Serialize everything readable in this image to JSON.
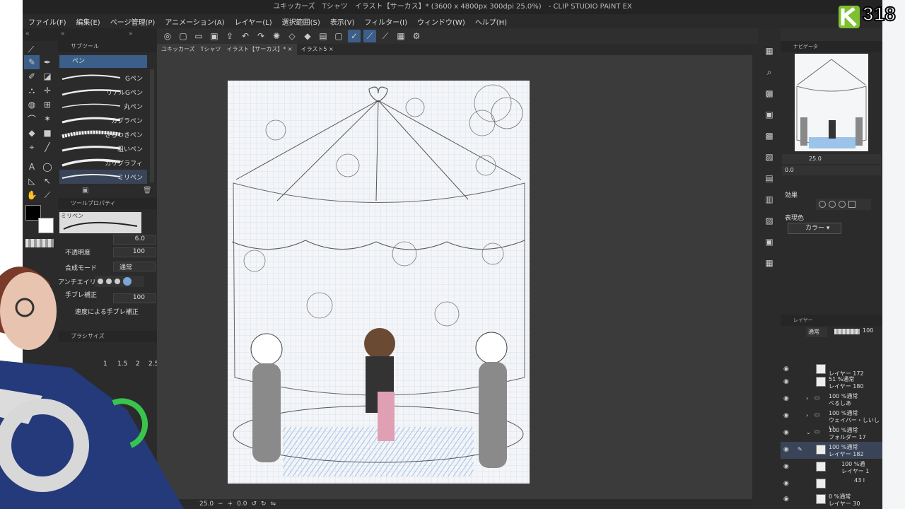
{
  "window": {
    "title": "ユキッカーズ　Tシャツ　イラスト【サーカス】* (3600 x 4800px 300dpi 25.0%)　- CLIP STUDIO PAINT EX"
  },
  "menu": [
    "ファイル(F)",
    "編集(E)",
    "ページ管理(P)",
    "アニメーション(A)",
    "レイヤー(L)",
    "選択範囲(S)",
    "表示(V)",
    "フィルター(I)",
    "ウィンドウ(W)",
    "ヘルプ(H)"
  ],
  "tabs": [
    {
      "label": "ユキッカーズ　Tシャツ　イラスト【サーカス】*"
    },
    {
      "label": "イラスト5"
    }
  ],
  "subtool": {
    "header": "サブツール",
    "group": "ペン",
    "pens": [
      "Gペン",
      "リアルGペン",
      "丸ペン",
      "カブラペン",
      "さらつきペン",
      "粗いペン",
      "カリグラフィ",
      "ミリペン"
    ]
  },
  "toolprop": {
    "header": "ツールプロパティ",
    "name": "ミリペン",
    "size": "6.0",
    "opacity_label": "不透明度",
    "opacity": "100",
    "blend_label": "合成モード",
    "blend": "通常",
    "aa_label": "アンチエイリ",
    "stab_label": "手ブレ補正",
    "stab": "100",
    "speed_label": "速度による手ブレ補正"
  },
  "brushsize": {
    "header": "ブラシサイズ",
    "values": [
      "1",
      "1.5",
      "2",
      "2.5"
    ]
  },
  "status": {
    "zoom": "25.0",
    "angle": "0.0"
  },
  "navigator": {
    "header": "ナビゲータ",
    "zoom": "25.0",
    "angle": "0.0"
  },
  "effects": {
    "title": "効果",
    "color_label": "表現色",
    "color": "カラー"
  },
  "layers": {
    "header": "レイヤー",
    "mode": "通常",
    "opacity": "100",
    "rows": [
      {
        "t1": "",
        "t2": "レイヤー 172"
      },
      {
        "t1": "51 %通常",
        "t2": "レイヤー 180"
      },
      {
        "t1": "100 %通常",
        "t2": "べるしあ"
      },
      {
        "t1": "100 %通常",
        "t2": "ウェイバー・しいしい"
      },
      {
        "t1": "100 %通常",
        "t2": "フォルダー 17"
      },
      {
        "t1": "100 %通常",
        "t2": "レイヤー 182"
      },
      {
        "t1": "100 %通",
        "t2": "レイヤー 1"
      },
      {
        "t1": "43 l",
        "t2": ""
      },
      {
        "t1": "0 %通常",
        "t2": "レイヤー 30"
      }
    ]
  },
  "logo": {
    "text": "318"
  },
  "colors": {
    "selected": "#3c5f8a",
    "accent": "#7dc12f",
    "wash": "#9cc3ea"
  }
}
